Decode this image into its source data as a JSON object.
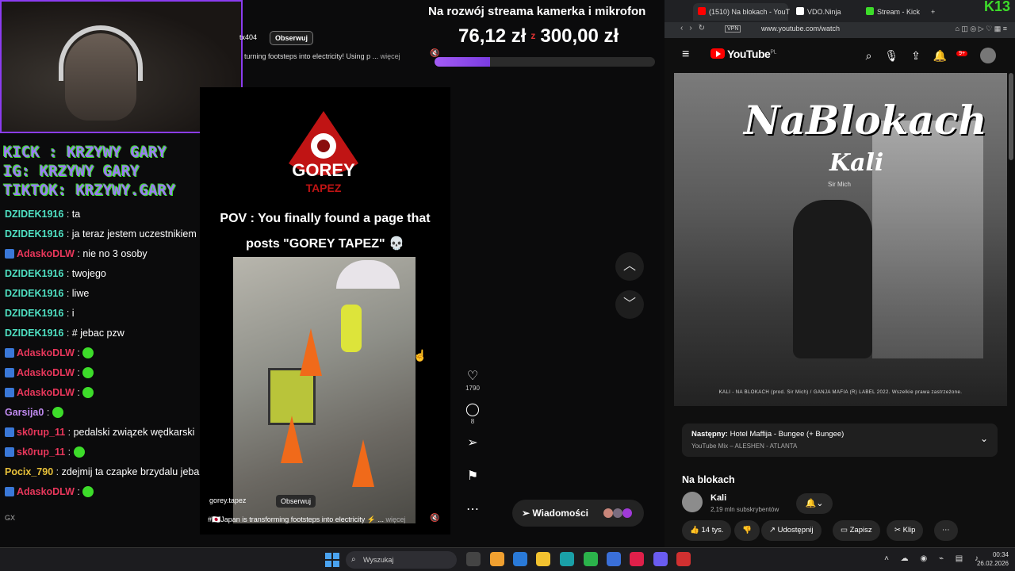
{
  "banner": {
    "text": "Na rozwój streama kamerka i mikrofon",
    "current": "76,12 zł",
    "separator": "z",
    "goal": "300,00 zł",
    "progress_fraction": 0.25
  },
  "overlay": {
    "line1": "KICK : KRZYWY GARY",
    "line2": "IG: KRZYWY GARY",
    "line3": "TIKTOK: KRZYWY.GARY"
  },
  "chat": {
    "messages": [
      {
        "user": "DZIDEK1916",
        "color": "#4fe0c2",
        "text": "ta",
        "badge": false
      },
      {
        "user": "DZIDEK1916",
        "color": "#4fe0c2",
        "text": "ja teraz jestem uczestnikiem",
        "badge": false
      },
      {
        "user": "AdaskoDLW",
        "color": "#e8375b",
        "text": "nie no 3 osoby",
        "badge": true
      },
      {
        "user": "DZIDEK1916",
        "color": "#4fe0c2",
        "text": "twojego",
        "badge": false
      },
      {
        "user": "DZIDEK1916",
        "color": "#4fe0c2",
        "text": "liwe",
        "badge": false
      },
      {
        "user": "DZIDEK1916",
        "color": "#4fe0c2",
        "text": "i",
        "badge": false
      },
      {
        "user": "DZIDEK1916",
        "color": "#4fe0c2",
        "text": "# jebac pzw",
        "badge": false
      },
      {
        "user": "AdaskoDLW",
        "color": "#e8375b",
        "text": "",
        "badge": true
      },
      {
        "user": "AdaskoDLW",
        "color": "#e8375b",
        "text": "",
        "badge": true
      },
      {
        "user": "AdaskoDLW",
        "color": "#e8375b",
        "text": "",
        "badge": true
      },
      {
        "user": "Garsija0",
        "color": "#c08af0",
        "text": "",
        "badge": false
      },
      {
        "user": "sk0rup_11",
        "color": "#e8375b",
        "text": "pedalski związek wędkarski",
        "badge": true
      },
      {
        "user": "sk0rup_11",
        "color": "#e8375b",
        "text": "",
        "badge": true
      },
      {
        "user": "Pocix_790",
        "color": "#e8c13a",
        "text": "zdejmij ta czapke brzydalu jeban",
        "badge": false
      },
      {
        "user": "AdaskoDLW",
        "color": "#e8375b",
        "text": "",
        "badge": true
      }
    ]
  },
  "reel_top": {
    "user": "tx404",
    "follow": "Obserwuj",
    "caption": "turning footsteps into electricity! Using p ...",
    "more": "więcej"
  },
  "reel": {
    "logo_top": "GOREY",
    "logo_bottom": "TAPEZ",
    "title_line1": "POV : You finally found a page that",
    "title_line2": "posts \"GOREY TAPEZ\" 💀",
    "user": "gorey.tapez",
    "follow": "Obserwuj",
    "caption": "#🇯🇵Japan is transforming footsteps into electricity ⚡ ...",
    "more": "więcej",
    "likes": "1790",
    "comments": "8"
  },
  "messages_btn": "Wiadomości",
  "browser": {
    "tabs": [
      {
        "label": "(1510) Na blokach - YouT",
        "color": "#f00"
      },
      {
        "label": "VDO.Ninja",
        "color": "#fff"
      },
      {
        "label": "Stream - Kick",
        "color": "#3ddc2a"
      }
    ],
    "k13": "K13",
    "url": "www.youtube.com/watch",
    "vpn": "VPN",
    "yt_logo": "YouTube",
    "yt_region": "PL",
    "notif_count": "9+",
    "thumb_title": "NaBlokach",
    "thumb_kali": "Kali",
    "thumb_sir": "Sir Mich",
    "thumb_footer": "KALI - NA BLOKACH (prod. Sir Mich) / GANJA MAFIA (R) LABEL 2022. Wszelkie prawa zastrzeżone.",
    "next_label": "Następny:",
    "next_title": "Hotel Maffija - Bungee (+ Bungee)",
    "next_sub": "YouTube Mix – ALESHEN - ATLANTA",
    "video_title": "Na blokach",
    "channel": "Kali",
    "subs": "2,19 mln subskrybentów",
    "likes": "14 tys.",
    "share": "Udostępnij",
    "save": "Zapisz",
    "clip": "Klip"
  },
  "taskbar": {
    "search_placeholder": "Wyszukaj",
    "time": "00:34",
    "date": "26.02.2026"
  }
}
